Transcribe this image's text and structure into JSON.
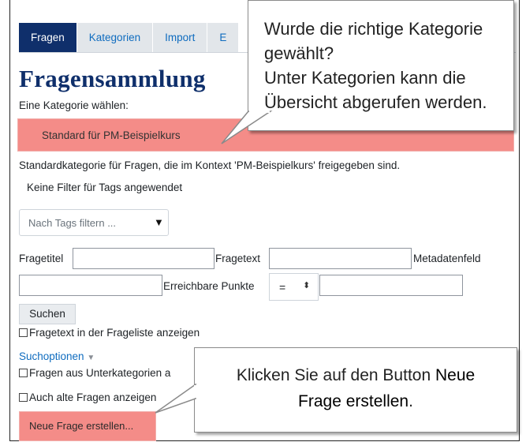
{
  "tabs": [
    {
      "label": "Fragen",
      "active": true
    },
    {
      "label": "Kategorien",
      "active": false
    },
    {
      "label": "Import",
      "active": false
    },
    {
      "label": "E",
      "active": false
    }
  ],
  "page_title": "Fragensammlung",
  "category": {
    "label": "Eine Kategorie wählen:",
    "selected": "Standard für PM-Beispielkurs",
    "description": "Standardkategorie für Fragen, die im Kontext 'PM-Beispielkurs' freigegeben sind."
  },
  "tags": {
    "status": "Keine Filter für Tags angewendet",
    "placeholder": "Nach Tags filtern ..."
  },
  "filters": {
    "fragetitel_label": "Fragetitel",
    "fragetext_label": "Fragetext",
    "metadaten_label": "Metadatenfeld",
    "punkte_label": "Erreichbare Punkte",
    "operator": "="
  },
  "search_button": "Suchen",
  "show_text_checkbox": "Fragetext in der Frageliste anzeigen",
  "search_options": "Suchoptionen",
  "subcategories_checkbox": "Fragen aus Unterkategorien a",
  "old_questions_checkbox": "Auch alte Fragen anzeigen",
  "new_question_button": "Neue Frage erstellen...",
  "callout_top": {
    "line1": "Wurde die richtige Kategorie",
    "line2": "gewählt?",
    "line3": "Unter Kategorien kann die",
    "line4": "Übersicht abgerufen werden."
  },
  "callout_bottom": {
    "prefix": "Klicken Sie auf den Button ",
    "highlight1": "Neue",
    "highlight2": "Frage erstellen",
    "suffix": "."
  },
  "colors": {
    "highlight": "#f48c88",
    "nav_active": "#0f2f6b",
    "link": "#0f6cbf"
  }
}
